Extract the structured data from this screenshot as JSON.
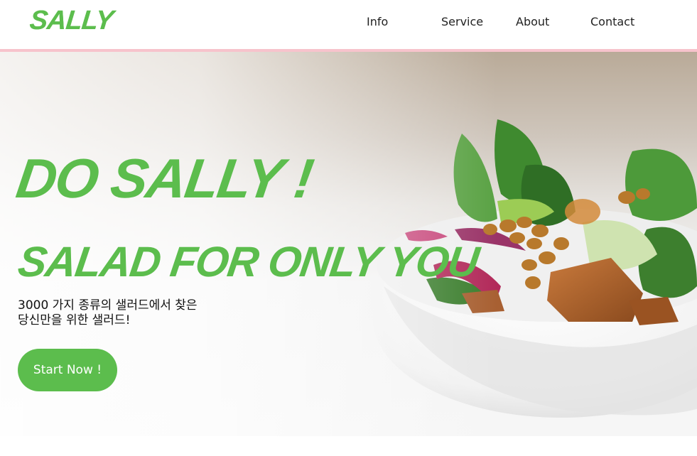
{
  "brand": {
    "logo_text": "SALLY",
    "accent_color": "#5cbd4d",
    "nav_border_color": "#f7c3cc"
  },
  "nav": {
    "items": [
      {
        "label": "Info"
      },
      {
        "label": "Service"
      },
      {
        "label": "About"
      },
      {
        "label": "Contact"
      }
    ]
  },
  "hero": {
    "headline": "DO SALLY !",
    "subheadline": "SALAD FOR ONLY YOU",
    "description_lines": [
      "3000 가지 종류의 샐러드에서 찾은",
      "당신만을 위한 샐러드!"
    ],
    "cta_label": "Start Now !",
    "image_subject": "salad-bowl-photo"
  }
}
